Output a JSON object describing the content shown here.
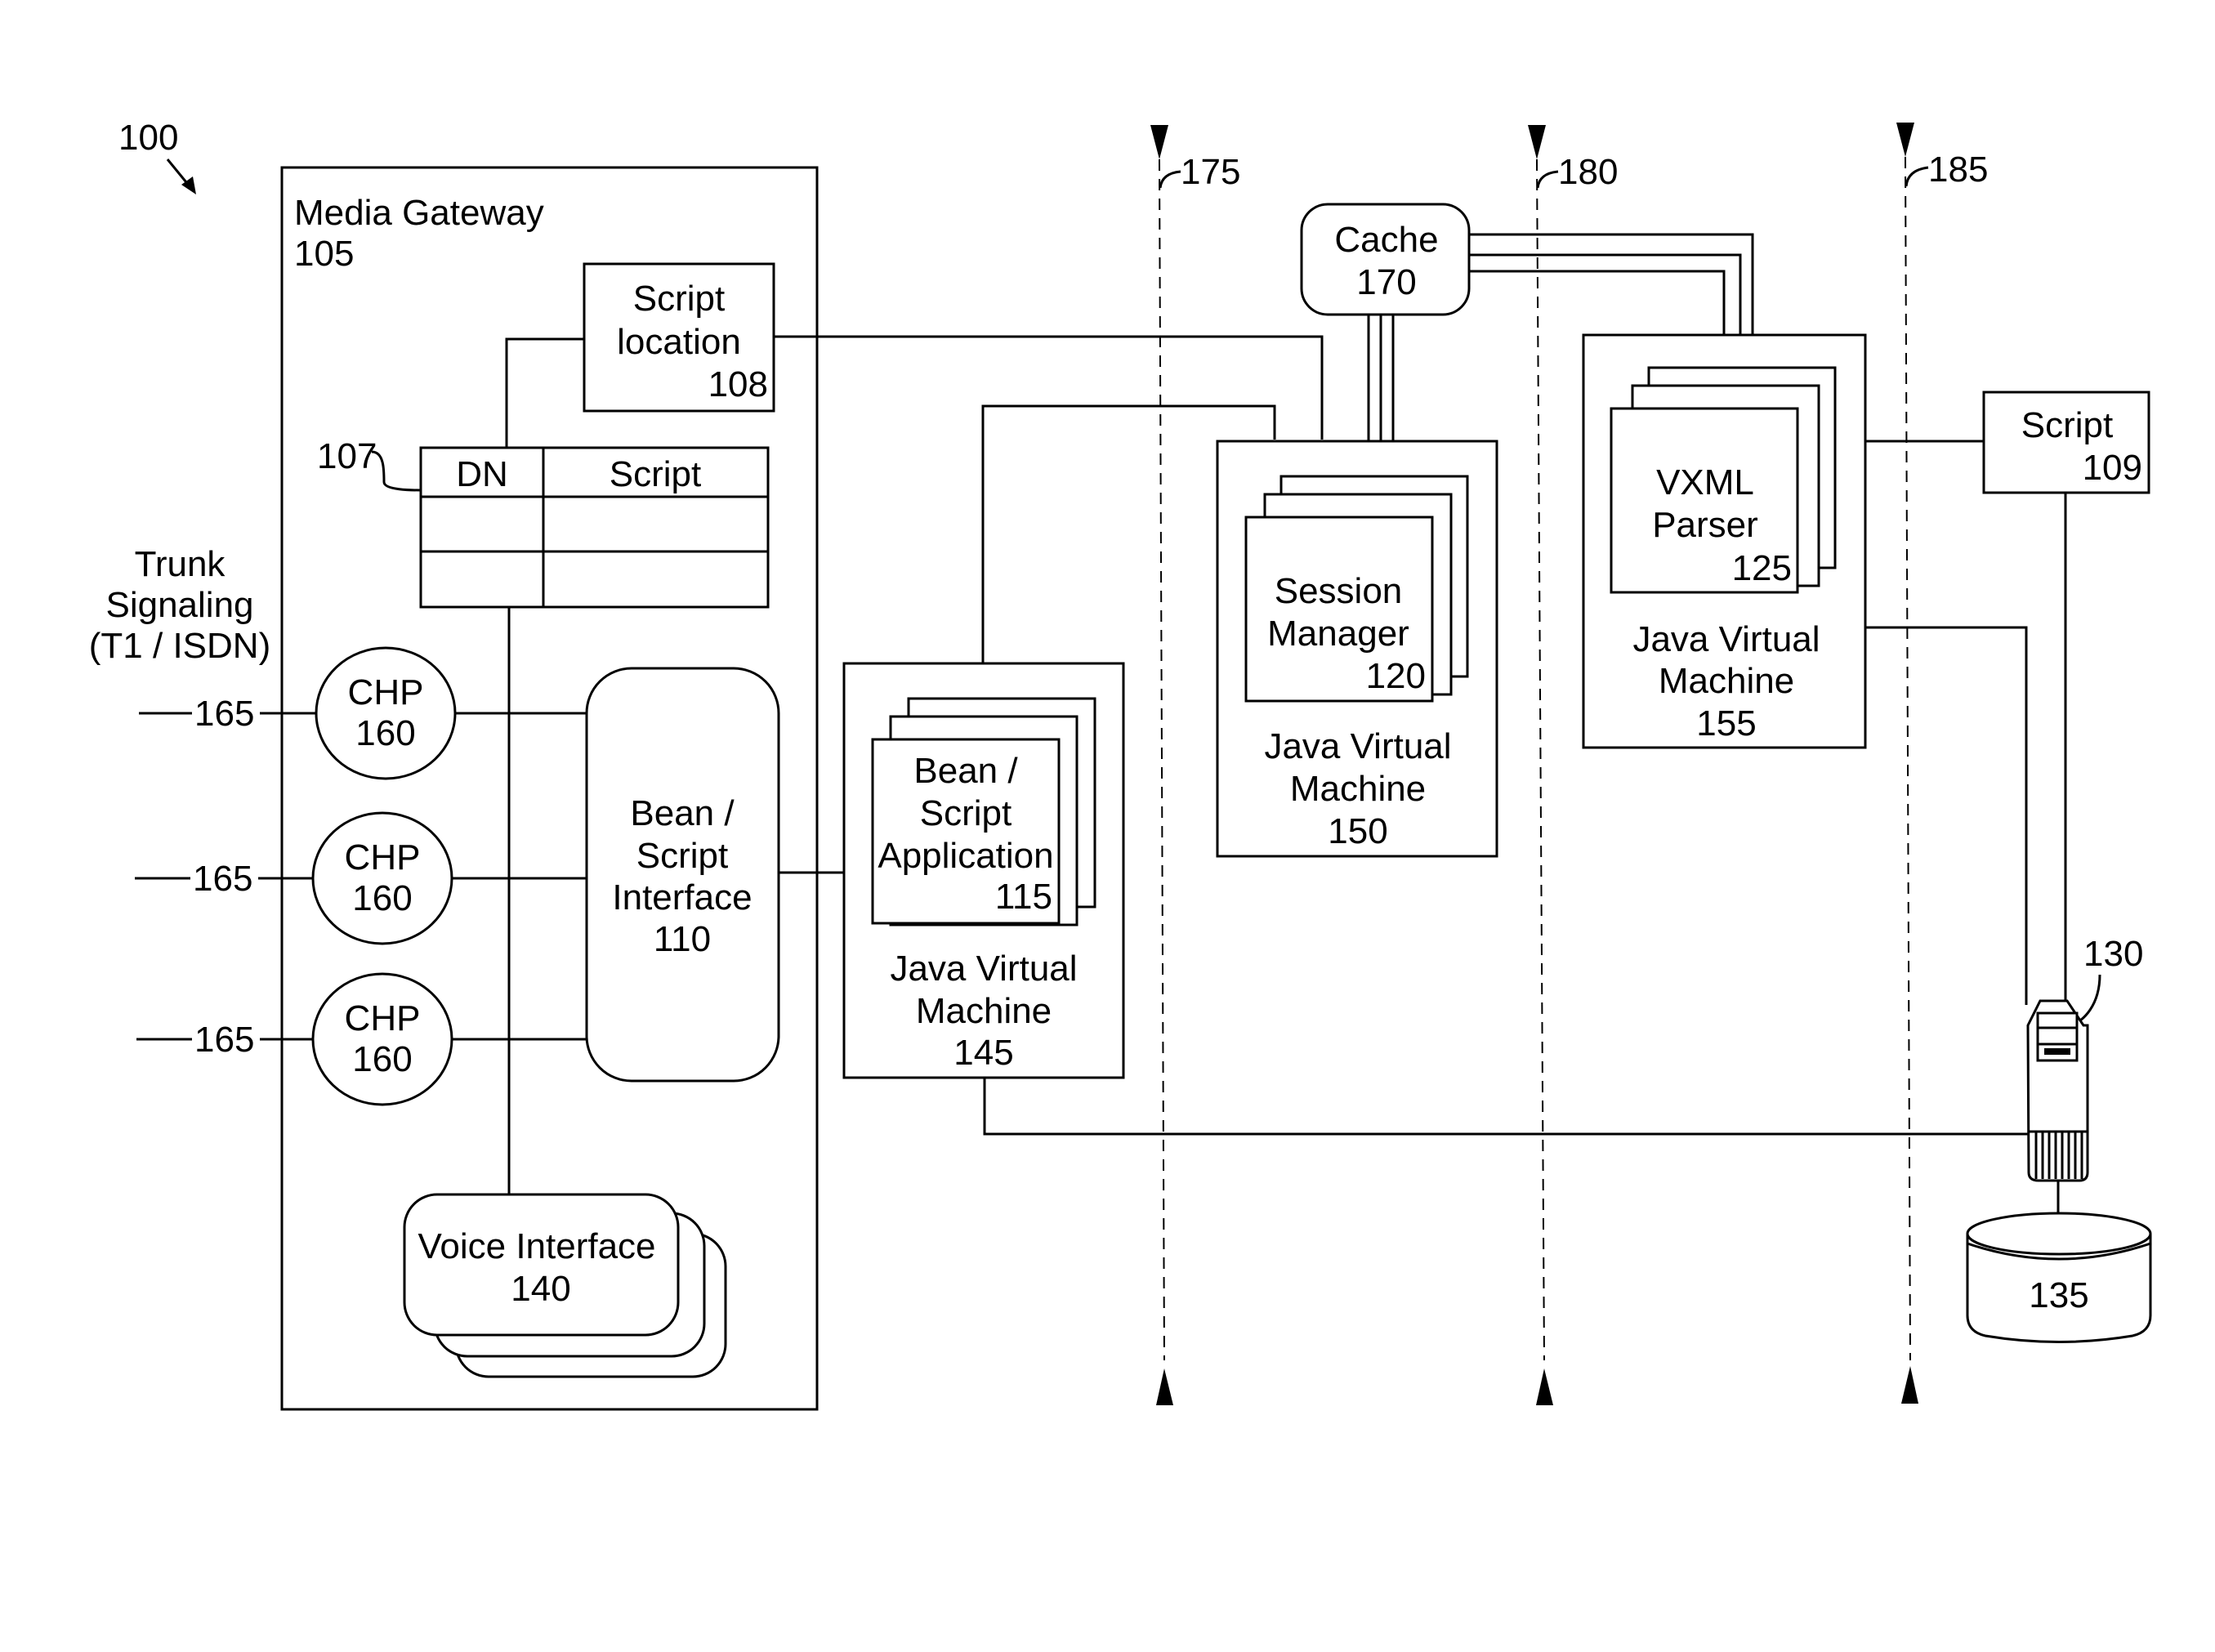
{
  "figure": {
    "ref": "100",
    "media_gateway": {
      "title": "Media Gateway",
      "ref": "105"
    },
    "script_location": {
      "line1": "Script",
      "line2": "location",
      "ref": "108"
    },
    "dn_table": {
      "ref": "107",
      "headers": [
        "DN",
        "Script"
      ],
      "rows": [
        [
          "",
          ""
        ],
        [
          "",
          ""
        ]
      ]
    },
    "trunk_signaling": {
      "line1": "Trunk",
      "line2": "Signaling",
      "line3": "(T1 / ISDN)"
    },
    "chp": [
      {
        "label": "CHP",
        "ref": "160",
        "line_ref": "165"
      },
      {
        "label": "CHP",
        "ref": "160",
        "line_ref": "165"
      },
      {
        "label": "CHP",
        "ref": "160",
        "line_ref": "165"
      }
    ],
    "bean_script_interface": {
      "line1": "Bean /",
      "line2": "Script",
      "line3": "Interface",
      "ref": "110"
    },
    "voice_interface": {
      "label": "Voice Interface",
      "ref": "140"
    },
    "jvm_145": {
      "line1": "Java Virtual",
      "line2": "Machine",
      "ref": "145",
      "app": {
        "line1": "Bean /",
        "line2": "Script",
        "line3": "Application",
        "ref": "115"
      }
    },
    "jvm_150": {
      "line1": "Java Virtual",
      "line2": "Machine",
      "ref": "150",
      "app": {
        "line1": "Session",
        "line2": "Manager",
        "ref": "120"
      }
    },
    "jvm_155": {
      "line1": "Java Virtual",
      "line2": "Machine",
      "ref": "155",
      "app": {
        "line1": "VXML",
        "line2": "Parser",
        "ref": "125"
      }
    },
    "cache": {
      "label": "Cache",
      "ref": "170"
    },
    "script_109": {
      "label": "Script",
      "ref": "109"
    },
    "server": {
      "ref": "130"
    },
    "database": {
      "ref": "135"
    },
    "boundaries": [
      {
        "ref": "175"
      },
      {
        "ref": "180"
      },
      {
        "ref": "185"
      }
    ]
  }
}
